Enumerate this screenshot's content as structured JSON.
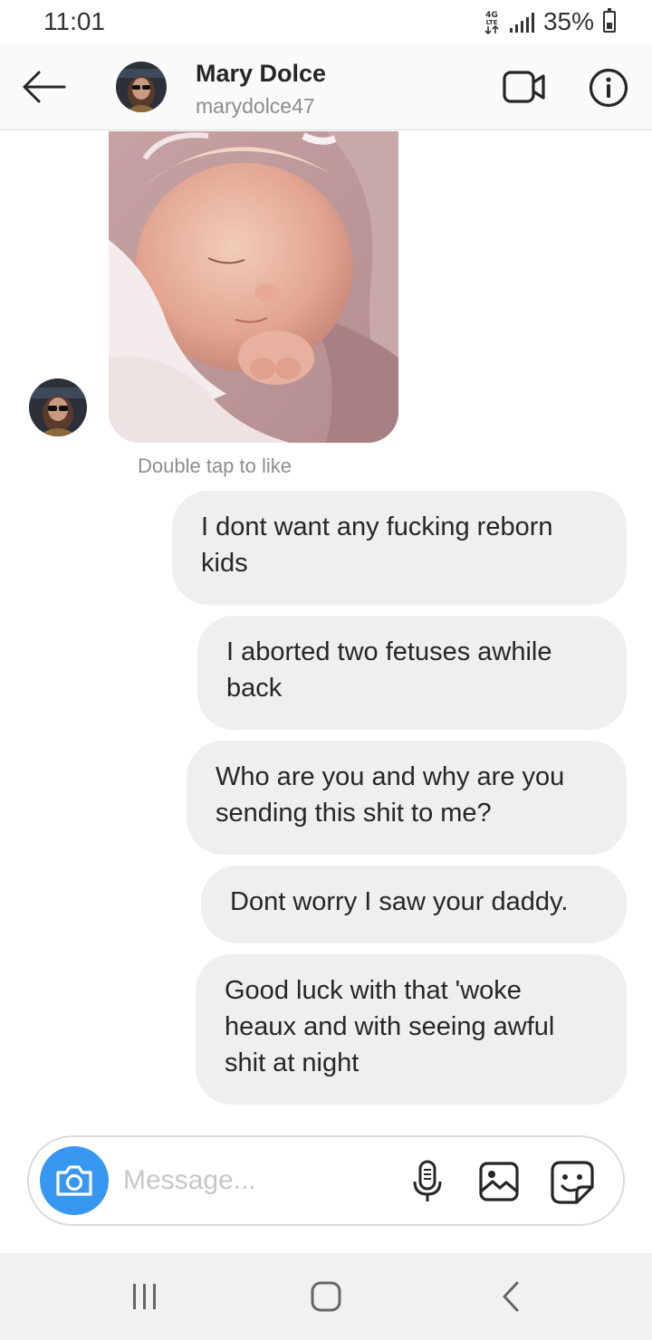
{
  "status_bar": {
    "time": "11:01",
    "network": "4G LTE",
    "battery": "35%"
  },
  "header": {
    "name": "Mary Dolce",
    "username": "marydolce47",
    "icons": [
      "back-arrow-icon",
      "video-call-icon",
      "info-icon"
    ]
  },
  "thread": {
    "photo_hint": "Double tap to like",
    "messages": [
      {
        "text": "I dont want any fucking reborn kids"
      },
      {
        "text": "I aborted two fetuses awhile back"
      },
      {
        "text": "Who are you and why are you sending this shit to me?"
      },
      {
        "text": "Dont worry I saw your daddy."
      },
      {
        "text": "Good luck with that 'woke heaux and with seeing awful shit at night"
      }
    ]
  },
  "composer": {
    "placeholder": "Message...",
    "icons": [
      "camera-icon",
      "microphone-icon",
      "gallery-icon",
      "sticker-icon"
    ]
  },
  "colors": {
    "accent": "#3897f0",
    "bubble": "#efefef",
    "secondary_text": "#8e8e8e"
  }
}
